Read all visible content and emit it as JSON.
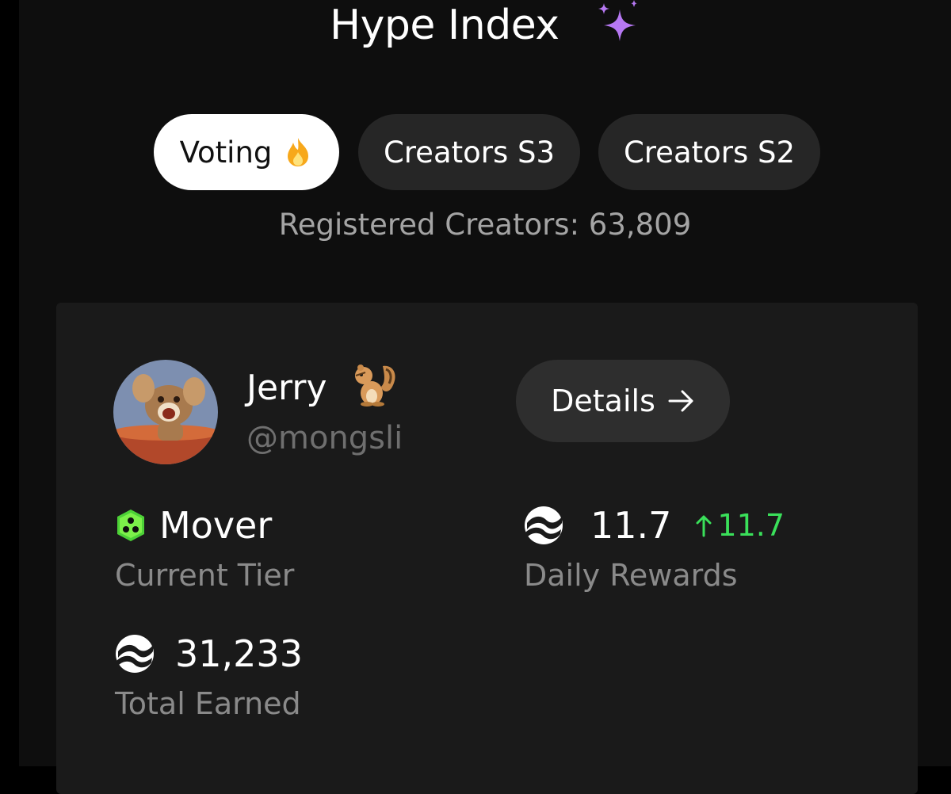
{
  "header": {
    "title": "Hype Index",
    "title_icon": "sparkles-icon"
  },
  "tabs": [
    {
      "label": "Voting",
      "icon": "fire-icon",
      "active": true
    },
    {
      "label": "Creators S3",
      "active": false
    },
    {
      "label": "Creators S2",
      "active": false
    }
  ],
  "registered_creators": "Registered Creators: 63,809",
  "profile": {
    "name": "Jerry",
    "name_icon": "chipmunk-icon",
    "handle": "@mongsli",
    "details_label": "Details"
  },
  "stats": {
    "tier": {
      "value": "Mover",
      "label": "Current Tier",
      "icon": "tier-hexagon-icon"
    },
    "daily_rewards": {
      "value": "11.7",
      "delta": "11.7",
      "label": "Daily Rewards",
      "icon": "token-icon"
    },
    "total_earned": {
      "value": "31,233",
      "label": "Total Earned",
      "icon": "token-icon"
    }
  },
  "colors": {
    "background": "#0e0e0e",
    "card": "#1a1a1a",
    "positive": "#3ae05a",
    "tier": "#4cd137",
    "sparkle": "#b678f2"
  }
}
